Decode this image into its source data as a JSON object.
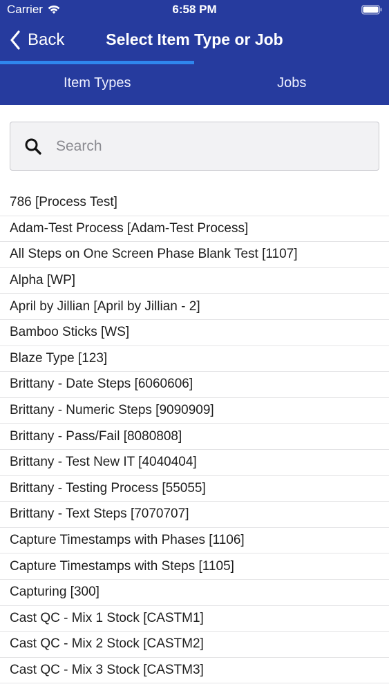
{
  "status_bar": {
    "carrier": "Carrier",
    "time": "6:58 PM"
  },
  "nav": {
    "back_label": "Back",
    "title": "Select Item Type or Job"
  },
  "tabs": [
    {
      "label": "Item Types",
      "selected": true
    },
    {
      "label": "Jobs",
      "selected": false
    }
  ],
  "search": {
    "placeholder": "Search",
    "value": ""
  },
  "items": [
    "786 [Process Test]",
    "Adam-Test Process [Adam-Test Process]",
    "All Steps on One Screen Phase Blank Test [1107]",
    "Alpha [WP]",
    "April by Jillian [April by Jillian - 2]",
    "Bamboo Sticks [WS]",
    "Blaze Type [123]",
    "Brittany - Date Steps [6060606]",
    "Brittany - Numeric Steps [9090909]",
    "Brittany - Pass/Fail [8080808]",
    "Brittany - Test New IT [4040404]",
    "Brittany - Testing Process [55055]",
    "Brittany - Text Steps [7070707]",
    "Capture Timestamps with Phases [1106]",
    "Capture Timestamps with Steps [1105]",
    "Capturing [300]",
    "Cast QC - Mix 1 Stock [CASTM1]",
    "Cast QC - Mix 2 Stock [CASTM2]",
    "Cast QC - Mix 3 Stock [CASTM3]"
  ],
  "colors": {
    "header": "#263b9e",
    "tab_indicator": "#2f86ee"
  },
  "icons": [
    "wifi-icon",
    "battery-icon",
    "chevron-left-icon",
    "search-icon"
  ]
}
